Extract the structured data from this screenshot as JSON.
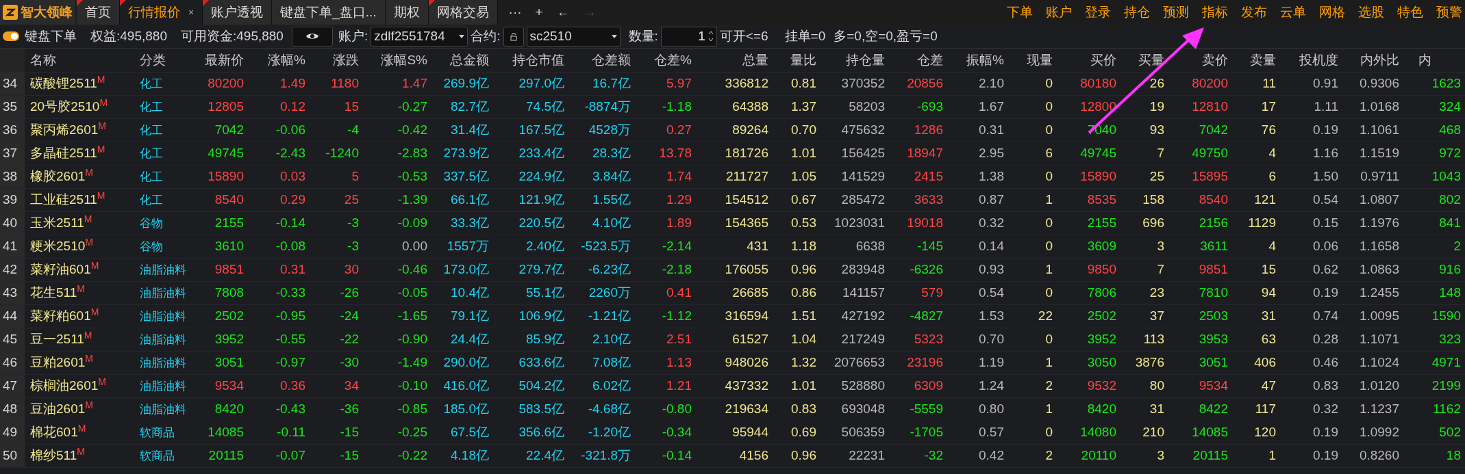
{
  "app": {
    "name": "智大领峰"
  },
  "tabs": [
    {
      "label": "首页",
      "selected": false,
      "flag": true
    },
    {
      "label": "行情报价",
      "selected": true,
      "flag": true,
      "close": "×"
    },
    {
      "label": "账户透视",
      "selected": false,
      "flag": true
    },
    {
      "label": "键盘下单_盘口...",
      "selected": false,
      "flag": false
    },
    {
      "label": "期权",
      "selected": false,
      "flag": false
    },
    {
      "label": "网格交易",
      "selected": false,
      "flag": true
    }
  ],
  "tab_controls": [
    {
      "label": "···",
      "disabled": false
    },
    {
      "label": "+",
      "disabled": false
    },
    {
      "label": "←",
      "disabled": false
    },
    {
      "label": "→",
      "disabled": true
    }
  ],
  "menu": [
    "下单",
    "账户",
    "登录",
    "持仓",
    "预测",
    "指标",
    "发布",
    "云单",
    "网格",
    "选股",
    "特色",
    "预警"
  ],
  "toolbar": {
    "keyboard_order": {
      "label": "键盘下单",
      "on": true
    },
    "equity": "权益:495,880",
    "available": "可用资金:495,880",
    "account_label": "账户:",
    "account": "zdlf2551784",
    "contract_label": "合约:",
    "contract": "sc2510",
    "qty_label": "数量:",
    "qty": "1",
    "status": [
      "可开<=6",
      "挂单=0",
      "多=0,空=0,盈亏=0"
    ]
  },
  "table": {
    "columns": [
      "名称",
      "分类",
      "最新价",
      "涨幅%",
      "涨跌",
      "涨幅S%",
      "总金额",
      "持仓市值",
      "仓差额",
      "仓差%",
      "总量",
      "量比",
      "持仓量",
      "仓差",
      "振幅%",
      "现量",
      "买价",
      "买量",
      "卖价",
      "卖量",
      "投机度",
      "内外比",
      "内"
    ],
    "rows": [
      {
        "no": "34",
        "cells": [
          "碳酸锂2511$^{M}$",
          "化工",
          "80200",
          "1.49",
          "1180",
          "1.47",
          "269.9亿",
          "297.0亿",
          "16.7亿",
          "5.97",
          "336812",
          "0.81",
          "370352",
          "20856",
          "2.10",
          "0",
          "80180",
          "26",
          "80200",
          "11",
          "0.91",
          "0.9306",
          "1623"
        ]
      },
      {
        "no": "35",
        "cells": [
          "20号胶2510$^{M}$",
          "化工",
          "12805",
          "0.12",
          "15",
          "-0.27",
          "82.7亿",
          "74.5亿",
          "-8874万",
          "-1.18",
          "64388",
          "1.37",
          "58203",
          "-693",
          "1.67",
          "0",
          "12800",
          "19",
          "12810",
          "17",
          "1.11",
          "1.0168",
          "324"
        ]
      },
      {
        "no": "36",
        "cells": [
          "聚丙烯2601$^{M}$",
          "化工",
          "7042",
          "-0.06",
          "-4",
          "-0.42",
          "31.4亿",
          "167.5亿",
          "4528万",
          "0.27",
          "89264",
          "0.70",
          "475632",
          "1286",
          "0.31",
          "0",
          "7040",
          "93",
          "7042",
          "76",
          "0.19",
          "1.1061",
          "468"
        ]
      },
      {
        "no": "37",
        "cells": [
          "多晶硅2511$^{M}$",
          "化工",
          "49745",
          "-2.43",
          "-1240",
          "-2.83",
          "273.9亿",
          "233.4亿",
          "28.3亿",
          "13.78",
          "181726",
          "1.01",
          "156425",
          "18947",
          "2.95",
          "6",
          "49745",
          "7",
          "49750",
          "4",
          "1.16",
          "1.1519",
          "972"
        ]
      },
      {
        "no": "38",
        "cells": [
          "橡胶2601$^{M}$",
          "化工",
          "15890",
          "0.03",
          "5",
          "-0.53",
          "337.5亿",
          "224.9亿",
          "3.84亿",
          "1.74",
          "211727",
          "1.05",
          "141529",
          "2415",
          "1.38",
          "0",
          "15890",
          "25",
          "15895",
          "6",
          "1.50",
          "0.9711",
          "1043"
        ]
      },
      {
        "no": "39",
        "cells": [
          "工业硅2511$^{M}$",
          "化工",
          "8540",
          "0.29",
          "25",
          "-1.39",
          "66.1亿",
          "121.9亿",
          "1.55亿",
          "1.29",
          "154512",
          "0.67",
          "285472",
          "3633",
          "0.87",
          "1",
          "8535",
          "158",
          "8540",
          "121",
          "0.54",
          "1.0807",
          "802"
        ]
      },
      {
        "no": "40",
        "cells": [
          "玉米2511$^{M}$",
          "谷物",
          "2155",
          "-0.14",
          "-3",
          "-0.09",
          "33.3亿",
          "220.5亿",
          "4.10亿",
          "1.89",
          "154365",
          "0.53",
          "1023031",
          "19018",
          "0.32",
          "0",
          "2155",
          "696",
          "2156",
          "1129",
          "0.15",
          "1.1976",
          "841"
        ]
      },
      {
        "no": "41",
        "cells": [
          "粳米2510$^{M}$",
          "谷物",
          "3610",
          "-0.08",
          "-3",
          "0.00",
          "1557万",
          "2.40亿",
          "-523.5万",
          "-2.14",
          "431",
          "1.18",
          "6638",
          "-145",
          "0.14",
          "0",
          "3609",
          "3",
          "3611",
          "4",
          "0.06",
          "1.1658",
          "2"
        ]
      },
      {
        "no": "42",
        "cells": [
          "菜籽油601$^{M}$",
          "油脂油料",
          "9851",
          "0.31",
          "30",
          "-0.46",
          "173.0亿",
          "279.7亿",
          "-6.23亿",
          "-2.18",
          "176055",
          "0.96",
          "283948",
          "-6326",
          "0.93",
          "1",
          "9850",
          "7",
          "9851",
          "15",
          "0.62",
          "1.0863",
          "916"
        ]
      },
      {
        "no": "43",
        "cells": [
          "花生511$^{M}$",
          "油脂油料",
          "7808",
          "-0.33",
          "-26",
          "-0.05",
          "10.4亿",
          "55.1亿",
          "2260万",
          "0.41",
          "26685",
          "0.86",
          "141157",
          "579",
          "0.54",
          "0",
          "7806",
          "23",
          "7810",
          "94",
          "0.19",
          "1.2455",
          "148"
        ]
      },
      {
        "no": "44",
        "cells": [
          "菜籽粕601$^{M}$",
          "油脂油料",
          "2502",
          "-0.95",
          "-24",
          "-1.65",
          "79.1亿",
          "106.9亿",
          "-1.21亿",
          "-1.12",
          "316594",
          "1.51",
          "427192",
          "-4827",
          "1.53",
          "22",
          "2502",
          "37",
          "2503",
          "31",
          "0.74",
          "1.0095",
          "1590"
        ]
      },
      {
        "no": "45",
        "cells": [
          "豆一2511$^{M}$",
          "油脂油料",
          "3952",
          "-0.55",
          "-22",
          "-0.90",
          "24.4亿",
          "85.9亿",
          "2.10亿",
          "2.51",
          "61527",
          "1.04",
          "217249",
          "5323",
          "0.70",
          "0",
          "3952",
          "113",
          "3953",
          "63",
          "0.28",
          "1.1071",
          "323"
        ]
      },
      {
        "no": "46",
        "cells": [
          "豆粕2601$^{M}$",
          "油脂油料",
          "3051",
          "-0.97",
          "-30",
          "-1.49",
          "290.0亿",
          "633.6亿",
          "7.08亿",
          "1.13",
          "948026",
          "1.32",
          "2076653",
          "23196",
          "1.19",
          "1",
          "3050",
          "3876",
          "3051",
          "406",
          "0.46",
          "1.1024",
          "4971"
        ]
      },
      {
        "no": "47",
        "cells": [
          "棕榈油2601$^{M}$",
          "油脂油料",
          "9534",
          "0.36",
          "34",
          "-0.10",
          "416.0亿",
          "504.2亿",
          "6.02亿",
          "1.21",
          "437332",
          "1.01",
          "528880",
          "6309",
          "1.24",
          "2",
          "9532",
          "80",
          "9534",
          "47",
          "0.83",
          "1.0120",
          "2199"
        ]
      },
      {
        "no": "48",
        "cells": [
          "豆油2601$^{M}$",
          "油脂油料",
          "8420",
          "-0.43",
          "-36",
          "-0.85",
          "185.0亿",
          "583.5亿",
          "-4.68亿",
          "-0.80",
          "219634",
          "0.83",
          "693048",
          "-5559",
          "0.80",
          "1",
          "8420",
          "31",
          "8422",
          "117",
          "0.32",
          "1.1237",
          "1162"
        ]
      },
      {
        "no": "49",
        "cells": [
          "棉花601$^{M}$",
          "软商品",
          "14085",
          "-0.11",
          "-15",
          "-0.25",
          "67.5亿",
          "356.6亿",
          "-1.20亿",
          "-0.34",
          "95944",
          "0.69",
          "506359",
          "-1705",
          "0.57",
          "0",
          "14080",
          "210",
          "14085",
          "120",
          "0.19",
          "1.0992",
          "502"
        ]
      },
      {
        "no": "50",
        "cells": [
          "棉纱511$^{M}$",
          "软商品",
          "20115",
          "-0.07",
          "-15",
          "-0.22",
          "4.18亿",
          "22.4亿",
          "-321.8万",
          "-0.14",
          "4156",
          "0.96",
          "22231",
          "-32",
          "0.42",
          "2",
          "20110",
          "3",
          "20115",
          "1",
          "0.19",
          "0.8260",
          "18"
        ]
      }
    ]
  }
}
